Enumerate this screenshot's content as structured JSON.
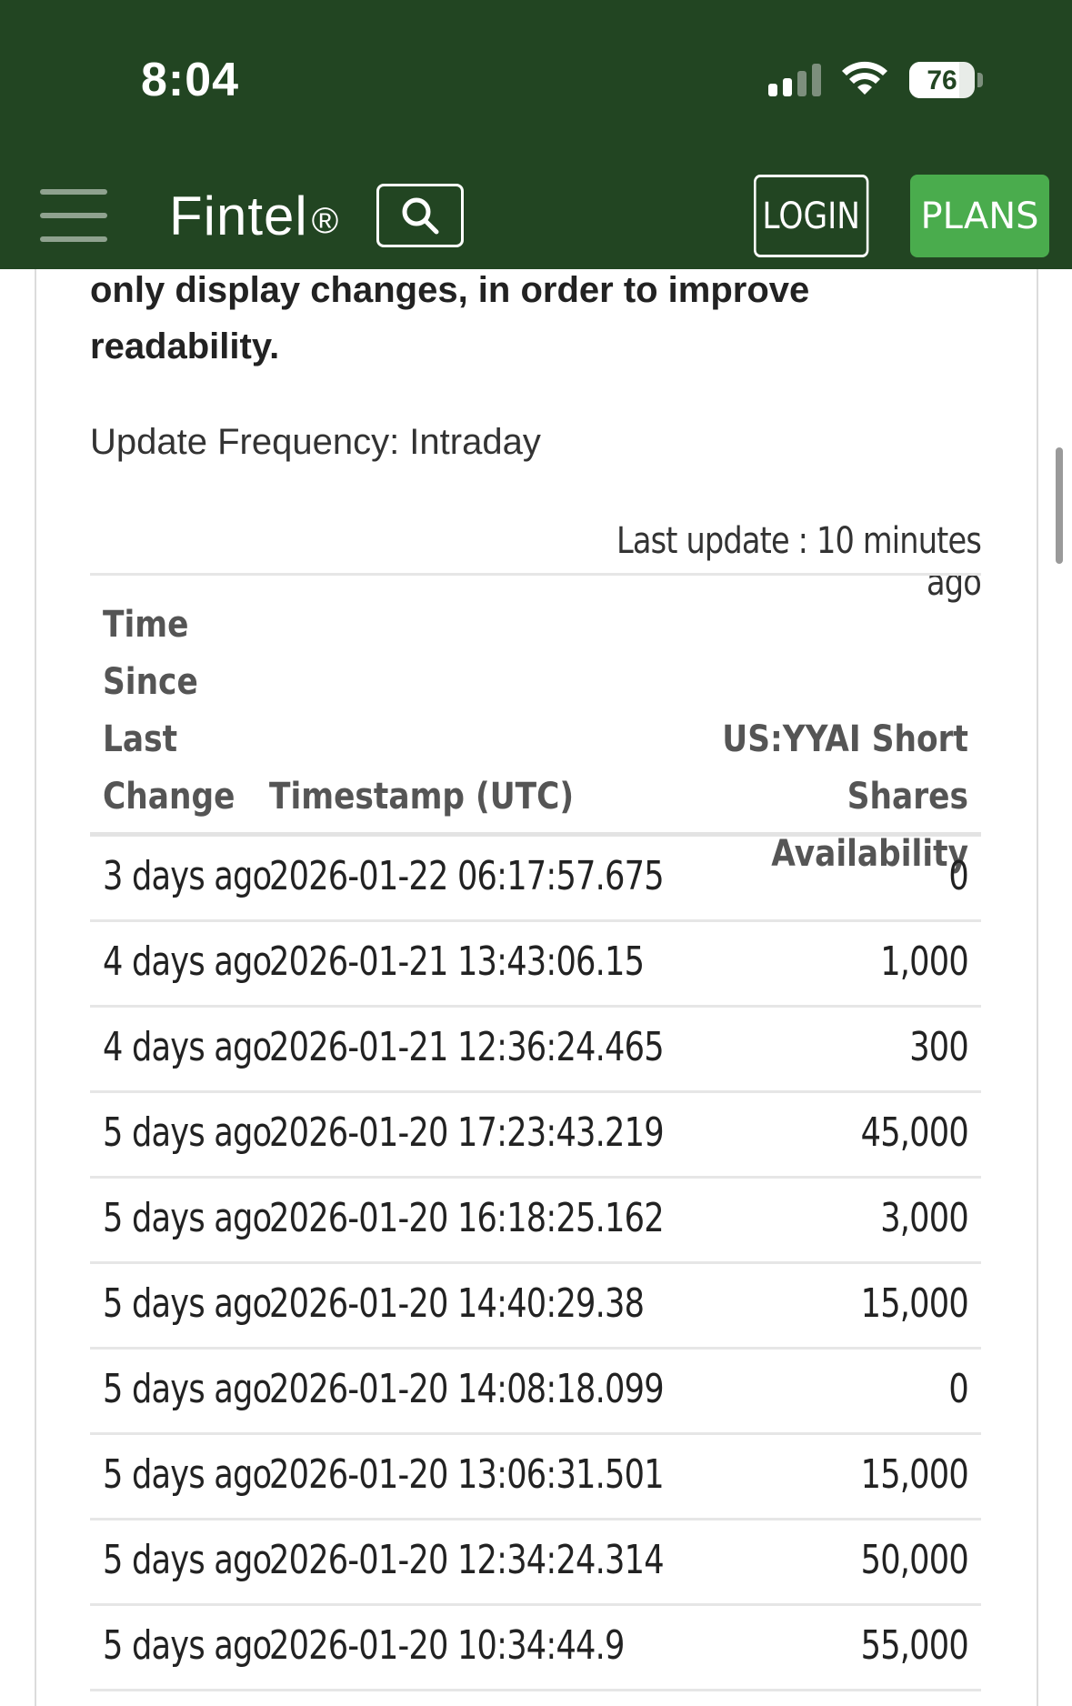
{
  "status_bar": {
    "time": "8:04",
    "battery": "76",
    "battery_level": 0.76,
    "signal_bars_active": 2,
    "signal_bars_total": 4
  },
  "nav": {
    "brand": "Fintel",
    "brand_mark": "®",
    "login_label": "LOGIN",
    "plans_label": "PLANS",
    "colors": {
      "background": "#224522",
      "plans": "#4aac4d"
    }
  },
  "content": {
    "note_text": "only display changes, in order to improve readability.",
    "update_frequency": "Update Frequency: Intraday",
    "last_update": "Last update : 10 minutes ago"
  },
  "table": {
    "headers": {
      "time_since": "Time Since Last Change",
      "timestamp": "Timestamp (UTC)",
      "availability": "US:YYAI Short Shares Availability"
    },
    "rows": [
      {
        "since": "3 days ago",
        "timestamp": "2026-01-22 06:17:57.675",
        "shares": "0"
      },
      {
        "since": "4 days ago",
        "timestamp": "2026-01-21 13:43:06.15",
        "shares": "1,000"
      },
      {
        "since": "4 days ago",
        "timestamp": "2026-01-21 12:36:24.465",
        "shares": "300"
      },
      {
        "since": "5 days ago",
        "timestamp": "2026-01-20 17:23:43.219",
        "shares": "45,000"
      },
      {
        "since": "5 days ago",
        "timestamp": "2026-01-20 16:18:25.162",
        "shares": "3,000"
      },
      {
        "since": "5 days ago",
        "timestamp": "2026-01-20 14:40:29.38",
        "shares": "15,000"
      },
      {
        "since": "5 days ago",
        "timestamp": "2026-01-20 14:08:18.099",
        "shares": "0"
      },
      {
        "since": "5 days ago",
        "timestamp": "2026-01-20 13:06:31.501",
        "shares": "15,000"
      },
      {
        "since": "5 days ago",
        "timestamp": "2026-01-20 12:34:24.314",
        "shares": "50,000"
      },
      {
        "since": "5 days ago",
        "timestamp": "2026-01-20 10:34:44.9",
        "shares": "55,000"
      }
    ]
  }
}
